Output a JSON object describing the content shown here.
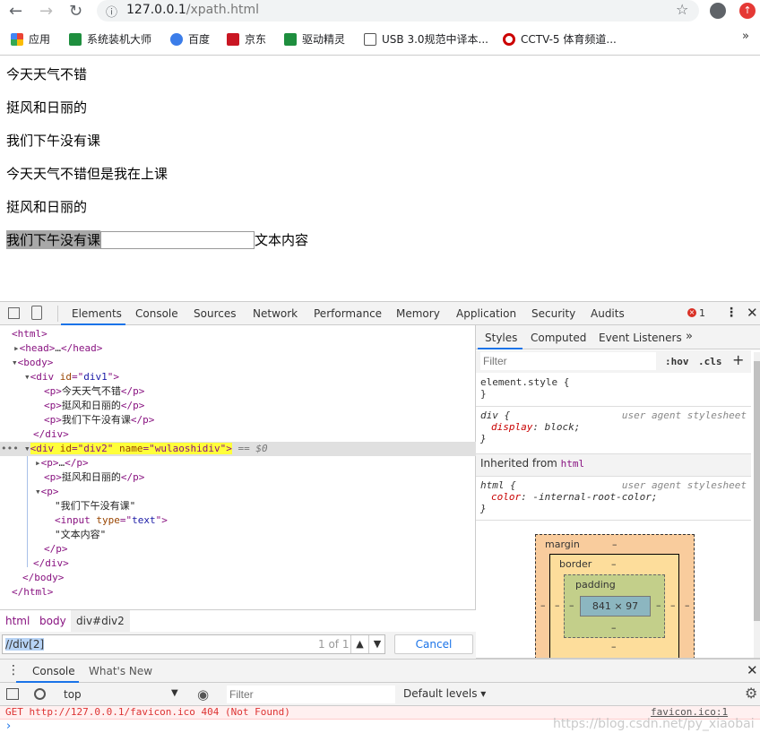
{
  "browser": {
    "url_host": "127.0.0.1",
    "url_path": "/xpath.html",
    "bookmarks": [
      "应用",
      "系统装机大师",
      "百度",
      "京东",
      "驱动精灵",
      "USB 3.0规范中译本...",
      "CCTV-5 体育频道..."
    ],
    "more": "»"
  },
  "page": {
    "lines": [
      "今天天气不错",
      "挺风和日丽的",
      "我们下午没有课",
      "今天天气不错但是我在上课",
      "挺风和日丽的"
    ],
    "last_text": "我们下午没有课",
    "after_input": "文本内容"
  },
  "devtools": {
    "tabs": [
      "Elements",
      "Console",
      "Sources",
      "Network",
      "Performance",
      "Memory",
      "Application",
      "Security",
      "Audits"
    ],
    "error_count": "1",
    "dom": {
      "selected_suffix": "== $0"
    },
    "styles_tabs": [
      "Styles",
      "Computed",
      "Event Listeners",
      "»"
    ],
    "filter_placeholder": "Filter",
    "hov": ":hov",
    "cls": ".cls",
    "plus": "+",
    "rules": {
      "element_style": "element.style {",
      "close": "}",
      "div_sel": "div {",
      "ua": "user agent stylesheet",
      "div_prop": "display",
      "div_val": "block;",
      "inherited": "Inherited from ",
      "inherited_tag": "html",
      "html_sel": "html {",
      "html_prop": "color",
      "html_val": "-internal-root-color;"
    },
    "box": {
      "margin": "margin",
      "border": "border",
      "padding": "padding",
      "content": "841 × 97",
      "dash": "–"
    },
    "breadcrumbs": [
      "html",
      "body",
      "div#div2"
    ],
    "search": {
      "value": "//div[2]",
      "count": "1 of 1",
      "cancel": "Cancel"
    },
    "drawer_tabs": [
      "Console",
      "What's New"
    ],
    "console": {
      "context": "top",
      "filter_placeholder": "Filter",
      "levels": "Default levels ▾",
      "error": "GET http://127.0.0.1/favicon.ico 404 (Not Found)",
      "error_src": "favicon.ico:1",
      "watermark": "https://blog.csdn.net/py_xiaobai"
    }
  }
}
